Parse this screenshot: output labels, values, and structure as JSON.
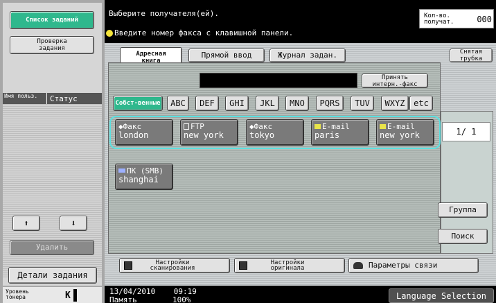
{
  "left": {
    "job_list_button": "Список заданий",
    "job_check_button": "Проверка задания",
    "col_user": "Имя польз.",
    "col_status": "Статус",
    "delete_button": "Удалить",
    "job_details_button": "Детали задания",
    "toner_label": "Уровень тонера",
    "toner_color": "K"
  },
  "header": {
    "title": "Выберите получателя(ей).",
    "hint": "Введите номер факса с клавишной панели.",
    "count_label": "Кол-во. получат.",
    "count_value": "000"
  },
  "tabs": {
    "address_book": "Адресная книга",
    "direct_input": "Прямой ввод",
    "job_log": "Журнал задан.",
    "on_hook": "Снятая трубка"
  },
  "internet_fax_button": "Принять интерн.-факс",
  "alpha_index": [
    "Собст-венные",
    "ABC",
    "DEF",
    "GHI",
    "JKL",
    "MNO",
    "PQRS",
    "TUV",
    "WXYZ",
    "etc"
  ],
  "destinations": [
    {
      "kind": "Факс",
      "name": "london"
    },
    {
      "kind": "FTP",
      "name": "new york"
    },
    {
      "kind": "Факс",
      "name": "tokyo"
    },
    {
      "kind": "E-mail",
      "name": "paris"
    },
    {
      "kind": "E-mail",
      "name": "new york"
    },
    {
      "kind": "ПК (SMB)",
      "name": "shanghai"
    }
  ],
  "page_indicator": "1/ 1",
  "group_button": "Группа",
  "search_button": "Поиск",
  "bottom_buttons": {
    "scan_settings": "Настройки сканирования",
    "original_settings": "Настройки оригинала",
    "comm_settings": "Параметры связи"
  },
  "footer": {
    "datetime": "13/04/2010    09:19",
    "memory_label": "Память",
    "memory_value": "100%",
    "language_button": "Language Selection"
  },
  "colors": {
    "accent": "#2fb88d",
    "highlight_ring": "#5ce0e0"
  }
}
